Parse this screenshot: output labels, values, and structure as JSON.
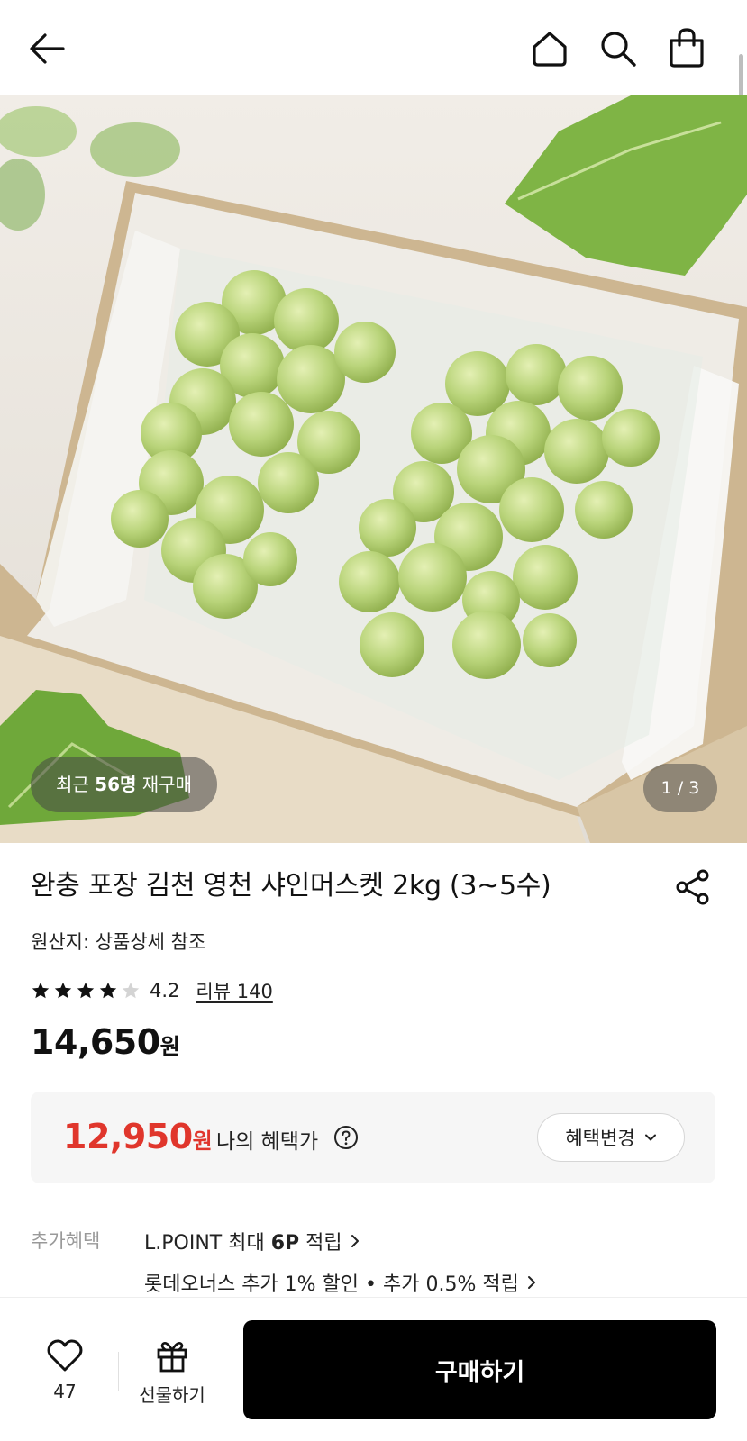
{
  "header": {
    "back_icon": "arrow-left-icon",
    "home_icon": "home-icon",
    "search_icon": "search-icon",
    "cart_icon": "shopping-bag-icon"
  },
  "gallery": {
    "repurchase_prefix": "최근 ",
    "repurchase_count": "56명",
    "repurchase_suffix": " 재구매",
    "pager": "1 / 3"
  },
  "product": {
    "title": "완충 포장 김천 영천 샤인머스켓 2kg (3~5수)",
    "origin": "원산지: 상품상세 참조",
    "rating": "4.2",
    "review_link": "리뷰 140",
    "price": "14,650",
    "price_unit": "원"
  },
  "benefit": {
    "price": "12,950",
    "price_unit": "원",
    "label": "나의 혜택가",
    "change_button": "혜택변경",
    "accent_color": "#e0362c"
  },
  "extra": {
    "label": "추가혜택",
    "line1_prefix": "L.POINT 최대 ",
    "line1_bold": "6P",
    "line1_suffix": " 적립",
    "line2": "롯데오너스 추가 1% 할인 • 추가 0.5% 적립"
  },
  "bottom": {
    "like_count": "47",
    "gift_label": "선물하기",
    "buy_label": "구매하기"
  }
}
